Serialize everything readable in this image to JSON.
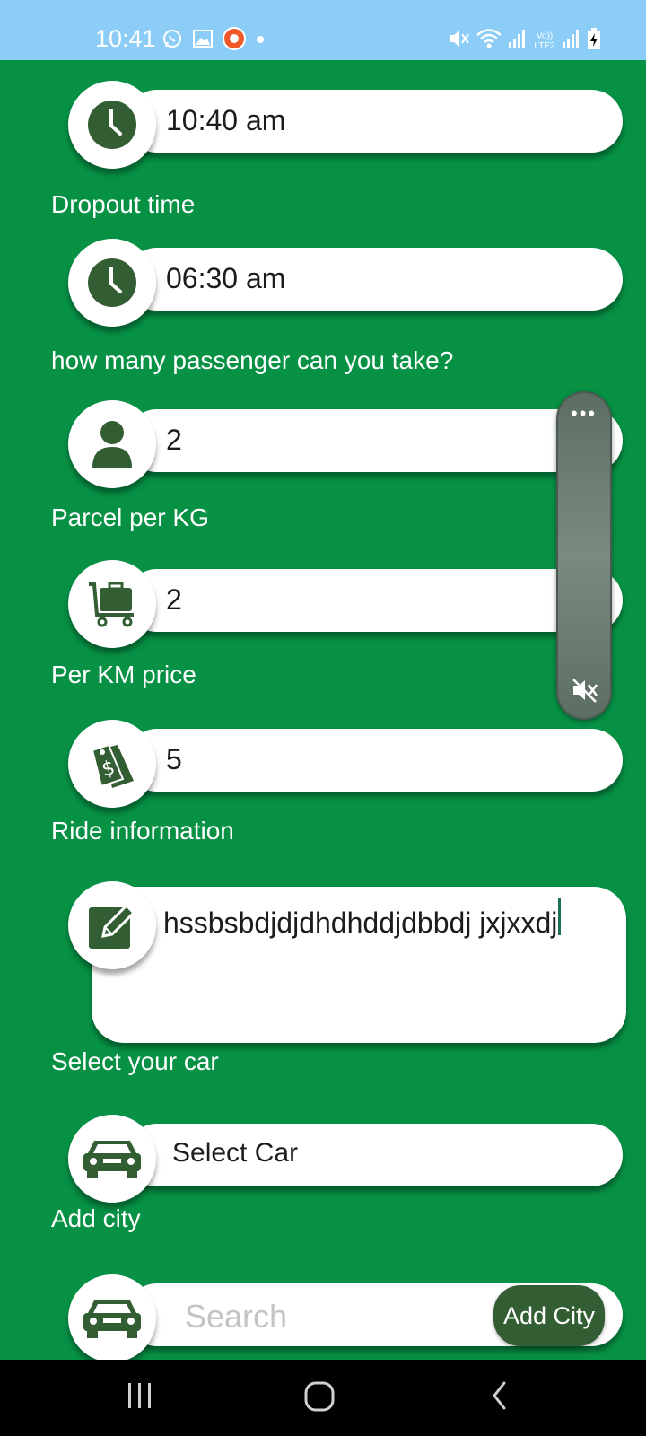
{
  "status_bar": {
    "time": "10:41",
    "left_icons": [
      "whatsapp-icon",
      "gallery-icon",
      "app-notification-icon",
      "dot-icon"
    ],
    "right_icons": [
      "mute-icon",
      "wifi-icon",
      "signal-icon",
      "volte-icon",
      "signal-icon",
      "battery-charging-icon"
    ],
    "volte_label": "Vo)) LTE2"
  },
  "form": {
    "pickup_time_value": "10:40 am",
    "dropout_label": "Dropout time",
    "dropout_value": "06:30 am",
    "passengers_label": "how many passenger can you take?",
    "passengers_value": "2",
    "parcel_label": "Parcel per KG",
    "parcel_value": "2",
    "price_label": "Per KM price",
    "price_value": "5",
    "ride_info_label": "Ride information",
    "ride_info_value": "hssbsbdjdjdhdhddjdbbdj jxjxxdj",
    "car_label": "Select your car",
    "car_value": "Select Car",
    "city_label": "Add city",
    "city_placeholder": "Search",
    "add_city_button": "Add City"
  },
  "volume_overlay": {
    "more_label": "•••",
    "icons": [
      "more-icon",
      "mute-icon"
    ]
  },
  "nav_bar": {
    "icons": [
      "recent-apps-icon",
      "home-icon",
      "back-icon"
    ]
  },
  "colors": {
    "background": "#069145",
    "icon_green": "#335e33",
    "status_bar": "#8ccdf8"
  }
}
